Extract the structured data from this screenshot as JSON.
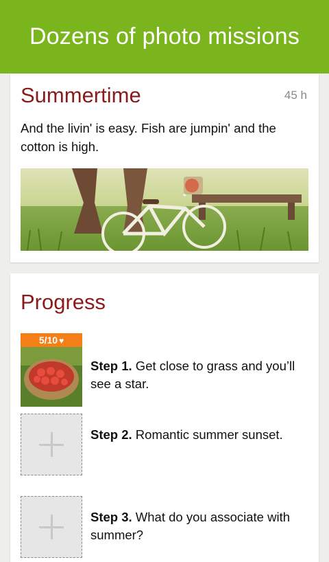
{
  "header": {
    "title": "Dozens of photo missions"
  },
  "mission": {
    "title": "Summertime",
    "time_left": "45 h",
    "description": "And the livin' is easy. Fish are jumpin' and the cotton is high."
  },
  "progress": {
    "title": "Progress",
    "steps": [
      {
        "number": "Step 1.",
        "text": " Get close to grass and you’ll see a star.",
        "badge": "5/10",
        "badge_icon": "heart-icon"
      },
      {
        "number": "Step 2.",
        "text": " Romantic summer sunset."
      },
      {
        "number": "Step 3.",
        "text": " What do you associate with summer?"
      }
    ]
  },
  "colors": {
    "header_bg": "#7ab51d",
    "title_red": "#8b1b1b",
    "badge_orange": "#f57f17"
  }
}
